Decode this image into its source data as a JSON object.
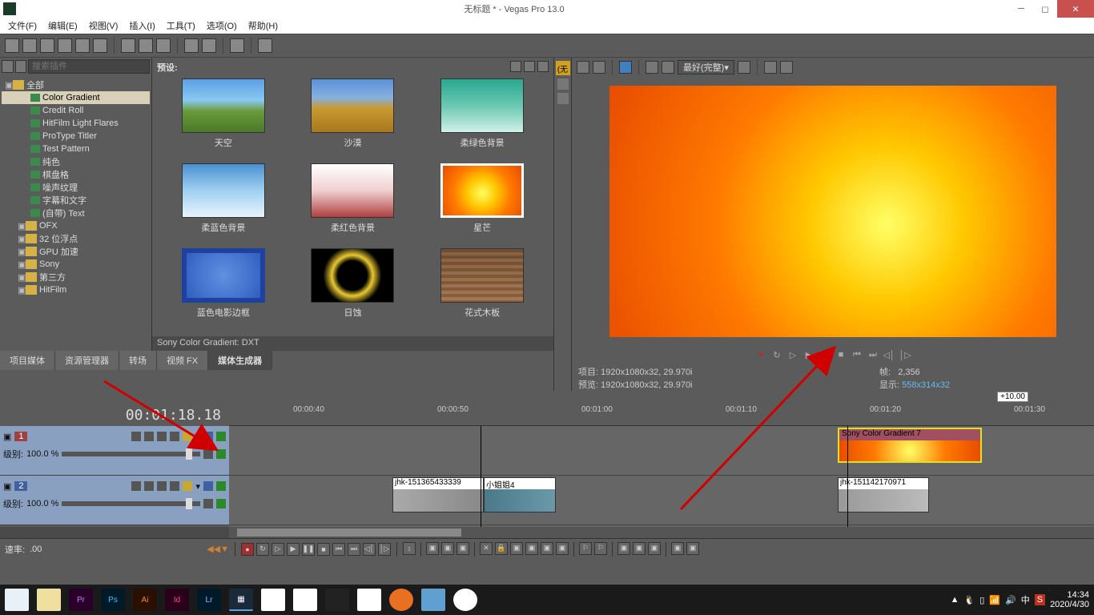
{
  "title": "无标题 * - Vegas Pro 13.0",
  "menu": [
    "文件(F)",
    "编辑(E)",
    "视图(V)",
    "插入(I)",
    "工具(T)",
    "选项(O)",
    "帮助(H)"
  ],
  "search_placeholder": "搜索插件",
  "tree": {
    "root": "全部",
    "items": [
      "Color Gradient",
      "Credit Roll",
      "HitFilm Light Flares",
      "ProType Titler",
      "Test Pattern",
      "纯色",
      "棋盘格",
      "噪声纹理",
      "字幕和文字",
      "(自带) Text"
    ],
    "folders": [
      "OFX",
      "32 位浮点",
      "GPU 加速",
      "Sony",
      "第三方",
      "HitFilm"
    ]
  },
  "presets": {
    "header": "预设:",
    "items": [
      "天空",
      "沙漠",
      "柔绿色背景",
      "柔蓝色背景",
      "柔红色背景",
      "星芒",
      "蓝色电影边框",
      "日蚀",
      "花式木板"
    ],
    "selected_index": 5,
    "status": "Sony Color Gradient: DXT"
  },
  "tabs": [
    "项目媒体",
    "资源管理器",
    "转场",
    "视频 FX",
    "媒体生成器"
  ],
  "active_tab": 4,
  "mid_tab": "(无",
  "preview": {
    "quality": "最好(完整)",
    "info_project_label": "项目:",
    "info_project": "1920x1080x32, 29.970i",
    "info_preview_label": "预览:",
    "info_preview": "1920x1080x32, 29.970i",
    "info_frame_label": "帧:",
    "info_frame": "2,356",
    "info_display_label": "显示:",
    "info_display": "558x314x32"
  },
  "zoom_label": "+10.00",
  "timeline": {
    "timecode": "00:01:18.18",
    "ticks": [
      "00:00:40",
      "00:00:50",
      "00:01:00",
      "00:01:10",
      "00:01:20",
      "00:01:30"
    ],
    "track1_num": "1",
    "track2_num": "2",
    "level_label": "级别:",
    "level_value": "100.0 %",
    "clip_gradient": "Sony Color Gradient 7",
    "clip_jhk1": "jhk-151365433339",
    "clip_jhk2": "小姐姐4",
    "clip_jhk3": "jhk-151142170971",
    "rate_label": "速率:",
    "rate_value": ".00"
  },
  "taskbar": {
    "time": "14:34",
    "date": "2020/4/30"
  }
}
